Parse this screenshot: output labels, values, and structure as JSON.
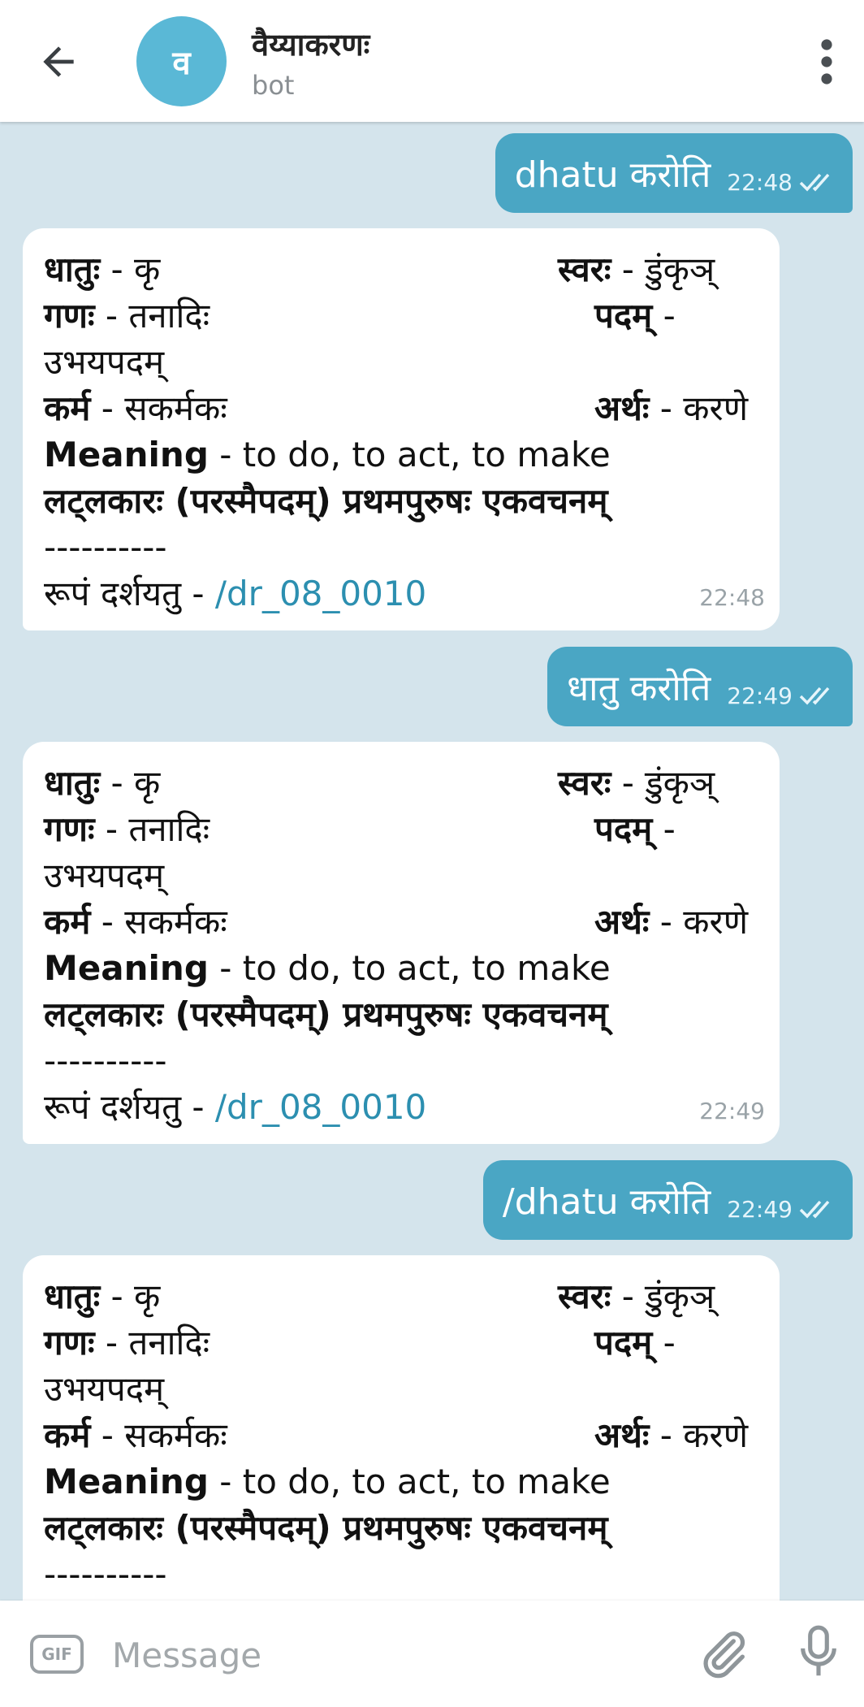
{
  "header": {
    "avatar_letter": "व",
    "title": "वैय्याकरणः",
    "subtitle": "bot",
    "back_icon": "arrow-left-icon",
    "menu_icon": "more-vertical-icon"
  },
  "messages": [
    {
      "type": "outgoing",
      "text": "dhatu करोति",
      "time": "22:48",
      "status": "read"
    },
    {
      "type": "incoming",
      "dhatu_label": "धातुः",
      "dhatu_value": " - कृ",
      "swara_label": "स्वरः",
      "swara_value": " - डुंकृञ्",
      "gana_label": "गणः",
      "gana_value": " - तनादिः",
      "pada_label": "पदम्",
      "pada_value": " -",
      "pada_cont": "उभयपदम्",
      "karma_label": "कर्म",
      "karma_value": " - सकर्मकः",
      "artha_label": "अर्थः",
      "artha_value": " - करणे",
      "meaning_label": "Meaning",
      "meaning_value": " - to do, to act, to make",
      "lakara": "लट्लकारः (परस्मैपदम्) प्रथमपुरुषः एकवचनम्",
      "separator": "----------",
      "rupa_label": "रूपं दर्शयतु - ",
      "rupa_link": "/dr_08_0010",
      "time": "22:48"
    },
    {
      "type": "outgoing",
      "text": "धातु करोति",
      "time": "22:49",
      "status": "read"
    },
    {
      "type": "incoming",
      "dhatu_label": "धातुः",
      "dhatu_value": " - कृ",
      "swara_label": "स्वरः",
      "swara_value": " - डुंकृञ्",
      "gana_label": "गणः",
      "gana_value": " - तनादिः",
      "pada_label": "पदम्",
      "pada_value": " -",
      "pada_cont": "उभयपदम्",
      "karma_label": "कर्म",
      "karma_value": " - सकर्मकः",
      "artha_label": "अर्थः",
      "artha_value": " - करणे",
      "meaning_label": "Meaning",
      "meaning_value": " - to do, to act, to make",
      "lakara": "लट्लकारः (परस्मैपदम्) प्रथमपुरुषः एकवचनम्",
      "separator": "----------",
      "rupa_label": "रूपं दर्शयतु - ",
      "rupa_link": "/dr_08_0010",
      "time": "22:49"
    },
    {
      "type": "outgoing",
      "text": "/dhatu करोति",
      "time": "22:49",
      "status": "read"
    },
    {
      "type": "incoming",
      "dhatu_label": "धातुः",
      "dhatu_value": " - कृ",
      "swara_label": "स्वरः",
      "swara_value": " - डुंकृञ्",
      "gana_label": "गणः",
      "gana_value": " - तनादिः",
      "pada_label": "पदम्",
      "pada_value": " -",
      "pada_cont": "उभयपदम्",
      "karma_label": "कर्म",
      "karma_value": " - सकर्मकः",
      "artha_label": "अर्थः",
      "artha_value": " - करणे",
      "meaning_label": "Meaning",
      "meaning_value": " - to do, to act, to make",
      "lakara": "लट्लकारः (परस्मैपदम्) प्रथमपुरुषः एकवचनम्",
      "separator": "----------"
    }
  ],
  "input_bar": {
    "placeholder": "Message",
    "gif_label": "GIF",
    "attach_icon": "paperclip-icon",
    "mic_icon": "microphone-icon"
  },
  "colors": {
    "chat_background": "#d4e4ec",
    "outgoing_bubble": "#4aa6c4",
    "incoming_bubble": "#ffffff",
    "link": "#2c8fb0",
    "avatar": "#5ab8d6"
  }
}
